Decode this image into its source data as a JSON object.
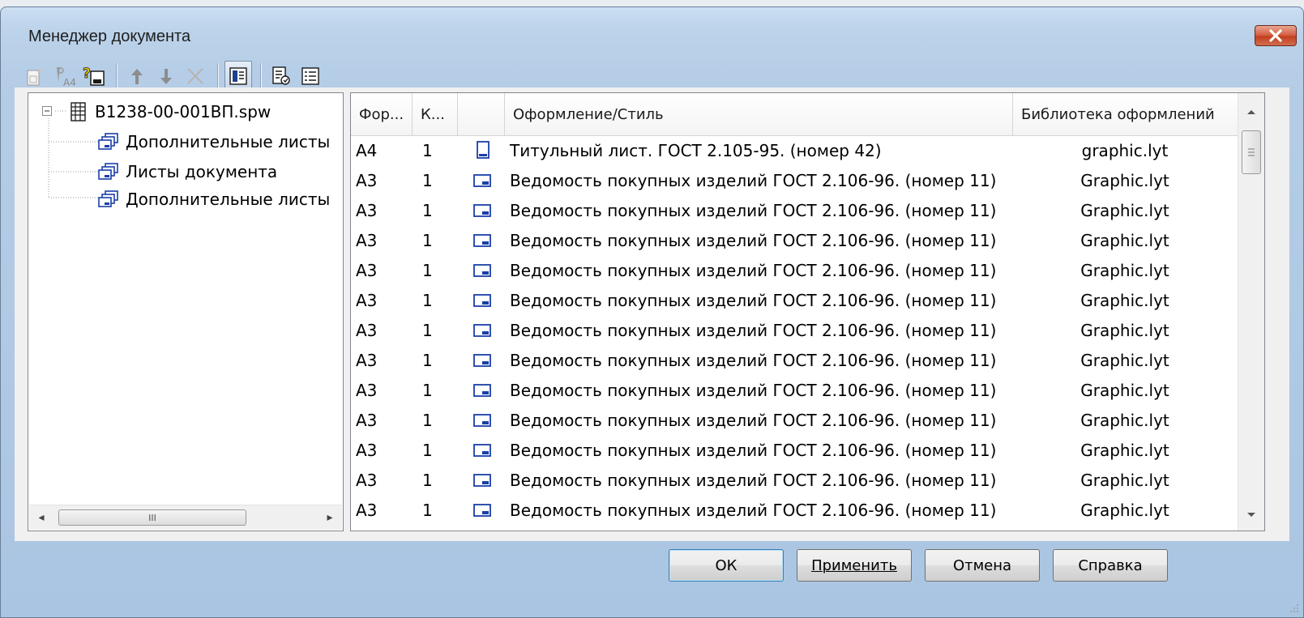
{
  "window": {
    "title": "Менеджер документа"
  },
  "tree": {
    "items": [
      {
        "label": "В1238-00-001ВП.spw",
        "level": 0
      },
      {
        "label": "Дополнительные листы",
        "level": 1
      },
      {
        "label": "Листы документа",
        "level": 1
      },
      {
        "label": "Дополнительные листы",
        "level": 1
      }
    ],
    "scroll_thumb_glyph": "III"
  },
  "grid": {
    "columns": [
      "Фор...",
      "К...",
      "",
      "Оформление/Стиль",
      "Библиотека оформлений"
    ],
    "rows": [
      {
        "format": "А4",
        "count": "1",
        "orientation": "portrait",
        "style": "Титульный лист. ГОСТ 2.105-95. (номер 42)",
        "library": "graphic.lyt"
      },
      {
        "format": "А3",
        "count": "1",
        "orientation": "landscape",
        "style": "Ведомость покупных изделий ГОСТ 2.106-96. (номер 11)",
        "library": "Graphic.lyt"
      },
      {
        "format": "А3",
        "count": "1",
        "orientation": "landscape",
        "style": "Ведомость покупных изделий ГОСТ 2.106-96. (номер 11)",
        "library": "Graphic.lyt"
      },
      {
        "format": "А3",
        "count": "1",
        "orientation": "landscape",
        "style": "Ведомость покупных изделий ГОСТ 2.106-96. (номер 11)",
        "library": "Graphic.lyt"
      },
      {
        "format": "А3",
        "count": "1",
        "orientation": "landscape",
        "style": "Ведомость покупных изделий ГОСТ 2.106-96. (номер 11)",
        "library": "Graphic.lyt"
      },
      {
        "format": "А3",
        "count": "1",
        "orientation": "landscape",
        "style": "Ведомость покупных изделий ГОСТ 2.106-96. (номер 11)",
        "library": "Graphic.lyt"
      },
      {
        "format": "А3",
        "count": "1",
        "orientation": "landscape",
        "style": "Ведомость покупных изделий ГОСТ 2.106-96. (номер 11)",
        "library": "Graphic.lyt"
      },
      {
        "format": "А3",
        "count": "1",
        "orientation": "landscape",
        "style": "Ведомость покупных изделий ГОСТ 2.106-96. (номер 11)",
        "library": "Graphic.lyt"
      },
      {
        "format": "А3",
        "count": "1",
        "orientation": "landscape",
        "style": "Ведомость покупных изделий ГОСТ 2.106-96. (номер 11)",
        "library": "Graphic.lyt"
      },
      {
        "format": "А3",
        "count": "1",
        "orientation": "landscape",
        "style": "Ведомость покупных изделий ГОСТ 2.106-96. (номер 11)",
        "library": "Graphic.lyt"
      },
      {
        "format": "А3",
        "count": "1",
        "orientation": "landscape",
        "style": "Ведомость покупных изделий ГОСТ 2.106-96. (номер 11)",
        "library": "Graphic.lyt"
      },
      {
        "format": "А3",
        "count": "1",
        "orientation": "landscape",
        "style": "Ведомость покупных изделий ГОСТ 2.106-96. (номер 11)",
        "library": "Graphic.lyt"
      },
      {
        "format": "А3",
        "count": "1",
        "orientation": "landscape",
        "style": "Ведомость покупных изделий ГОСТ 2.106-96. (номер 11)",
        "library": "Graphic.lyt"
      }
    ]
  },
  "buttons": {
    "ok": "ОК",
    "apply": "Применить",
    "cancel": "Отмена",
    "help": "Справка"
  },
  "toolbar": {
    "icons": [
      "new-sheet-icon",
      "format-a4-icon",
      "sheet-properties-icon",
      "move-up-icon",
      "move-down-icon",
      "delete-icon",
      "show-tree-icon",
      "document-properties-icon",
      "list-view-icon"
    ]
  },
  "colors": {
    "accent": "#1a3fa8",
    "close": "#c2401f"
  }
}
